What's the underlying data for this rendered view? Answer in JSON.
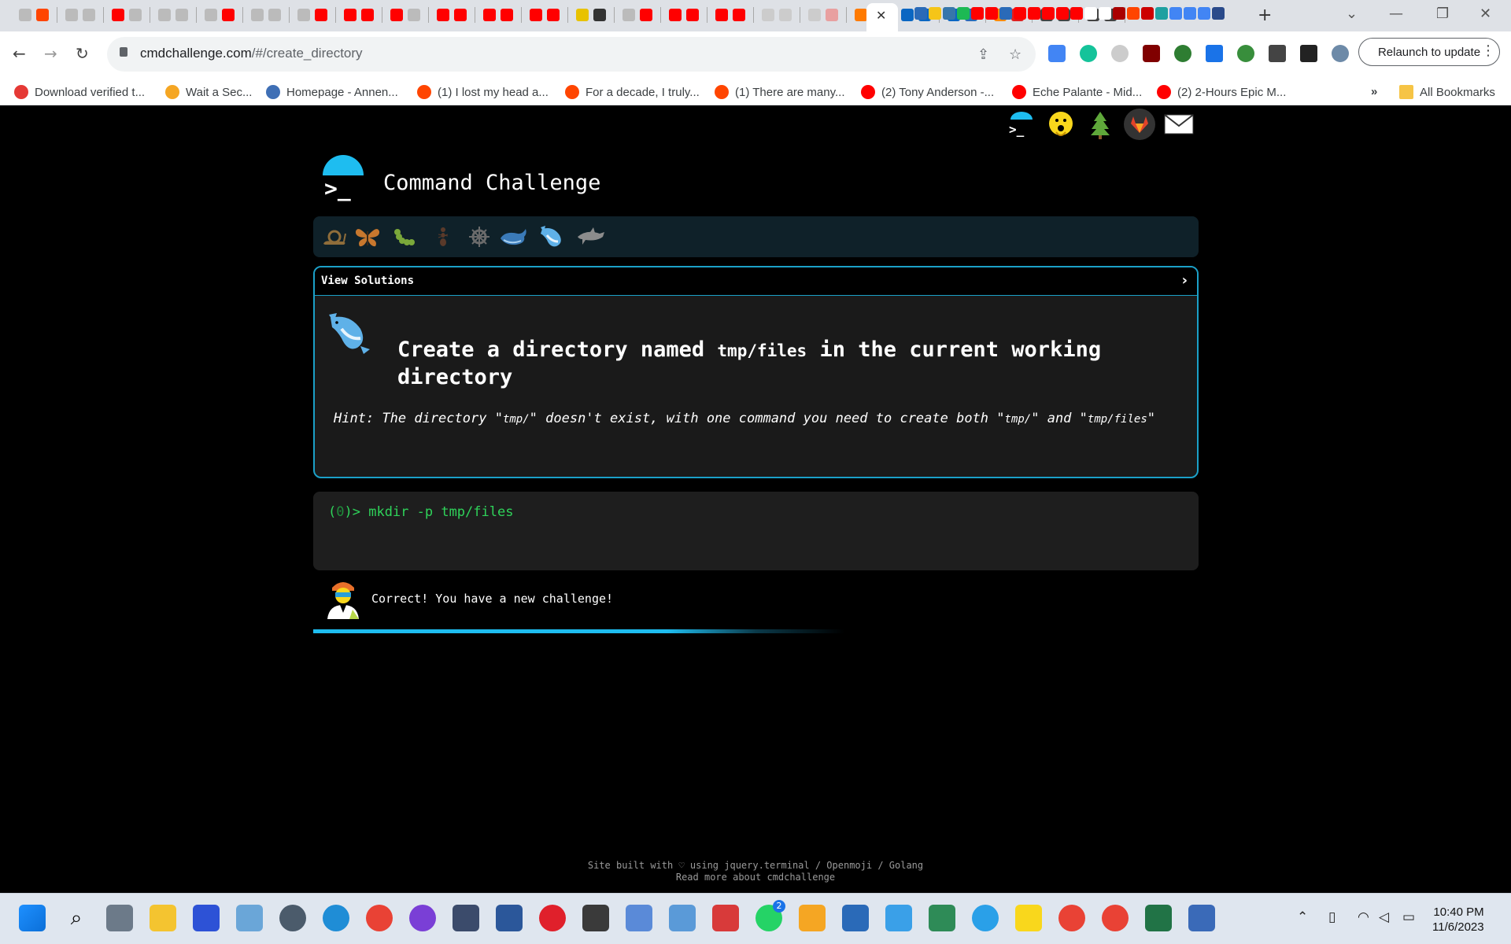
{
  "browser": {
    "url_host": "cmdchallenge.com",
    "url_path": "/#/create_directory",
    "relaunch_label": "Relaunch to update",
    "new_tab": "+",
    "close_tab": "✕",
    "bookmarks": [
      {
        "label": "Download verified t...",
        "color": "#e53935"
      },
      {
        "label": "Wait a Sec...",
        "color": "#f5a623"
      },
      {
        "label": "Homepage - Annen...",
        "color": "#3f6fb5"
      },
      {
        "label": "(1) I lost my head a...",
        "color": "#ff4500"
      },
      {
        "label": "For a decade, I truly...",
        "color": "#ff4500"
      },
      {
        "label": "(1) There are many...",
        "color": "#ff4500"
      },
      {
        "label": "(2) Tony Anderson -...",
        "color": "#ff0000"
      },
      {
        "label": "Eche Palante - Mid...",
        "color": "#ff0000"
      },
      {
        "label": "(2) 2-Hours Epic M...",
        "color": "#ff0000"
      }
    ],
    "bookmarks_more": "»",
    "all_bookmarks": "All Bookmarks"
  },
  "site": {
    "title": "Command Challenge",
    "brand_prompt": ">_",
    "levels": [
      "snail",
      "butterfly",
      "caterpillar",
      "ant",
      "ship-wheel",
      "whale",
      "whale-blue",
      "dolphin"
    ],
    "view_solutions": "View Solutions",
    "chevron": "›",
    "challenge_prefix": "Create a directory named",
    "challenge_code": "tmp/files",
    "challenge_suffix": "in the current working directory",
    "hint_1": "Hint: The directory \"",
    "hint_code_1": "tmp/",
    "hint_2": "\" doesn't exist, with one command you need to create both \"",
    "hint_code_2": "tmp/",
    "hint_3": "\" and \"",
    "hint_code_3": "tmp/files",
    "hint_4": "\"",
    "prompt_open": "(",
    "prompt_zero": "0",
    "prompt_close": ")> ",
    "command": "mkdir -p tmp/files",
    "result_message": "Correct! You have a new challenge!",
    "footer_line1": "Site built with ♡ using jquery.terminal / Openmoji / Golang",
    "footer_line2": "Read more about cmdchallenge"
  },
  "taskbar": {
    "time": "10:40 PM",
    "date": "11/6/2023",
    "whatsapp_badge": "2"
  }
}
